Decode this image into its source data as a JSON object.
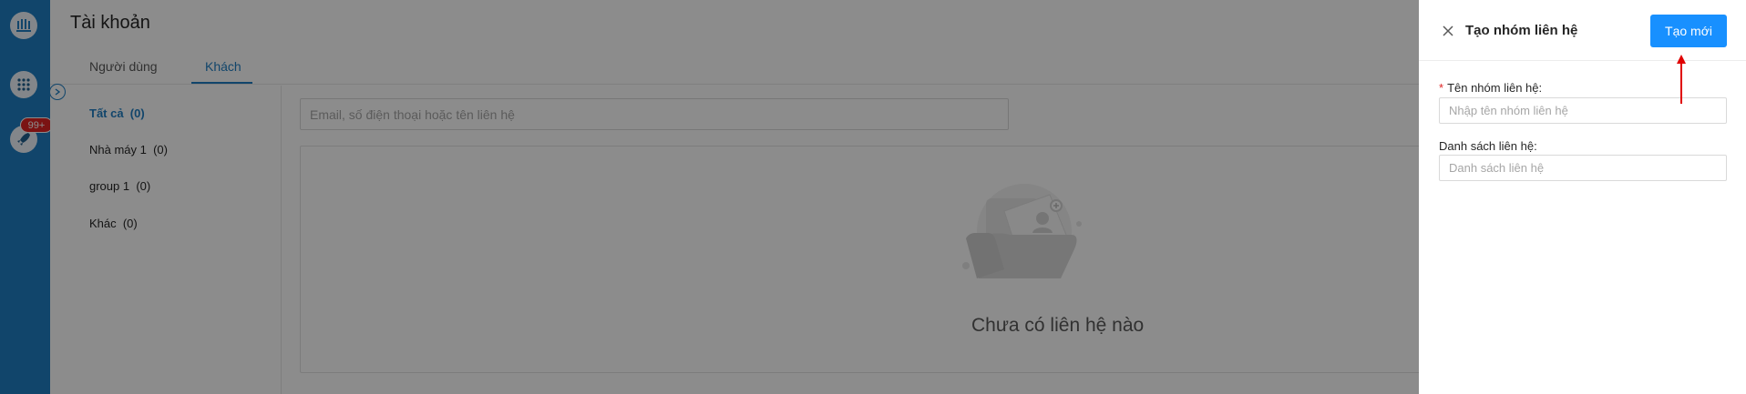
{
  "sidebar": {
    "notification_count": "99+",
    "icons": [
      "app-logo-icon",
      "apps-grid-icon",
      "rocket-icon"
    ]
  },
  "page": {
    "title": "Tài khoản",
    "tabs": [
      {
        "label": "Người dùng",
        "active": false
      },
      {
        "label": "Khách",
        "active": true
      }
    ],
    "groups": [
      {
        "label": "Tất cả  (0)",
        "active": true
      },
      {
        "label": "Nhà máy 1  (0)",
        "active": false
      },
      {
        "label": "group 1  (0)",
        "active": false
      },
      {
        "label": "Khác  (0)",
        "active": false
      }
    ],
    "search_placeholder": "Email, số điện thoại hoặc tên liên hệ",
    "empty_text": "Chưa có liên hệ nào"
  },
  "drawer": {
    "title": "Tạo nhóm liên hệ",
    "create_label": "Tạo mới",
    "fields": [
      {
        "label": "Tên nhóm liên hệ:",
        "required": true,
        "placeholder": "Nhập tên nhóm liên hệ"
      },
      {
        "label": "Danh sách liên hệ:",
        "required": false,
        "placeholder": "Danh sách liên hệ"
      }
    ]
  },
  "colors": {
    "primary": "#1f7fc4",
    "button": "#1890ff",
    "badge": "#e02424",
    "annotation_arrow": "#e00000"
  }
}
